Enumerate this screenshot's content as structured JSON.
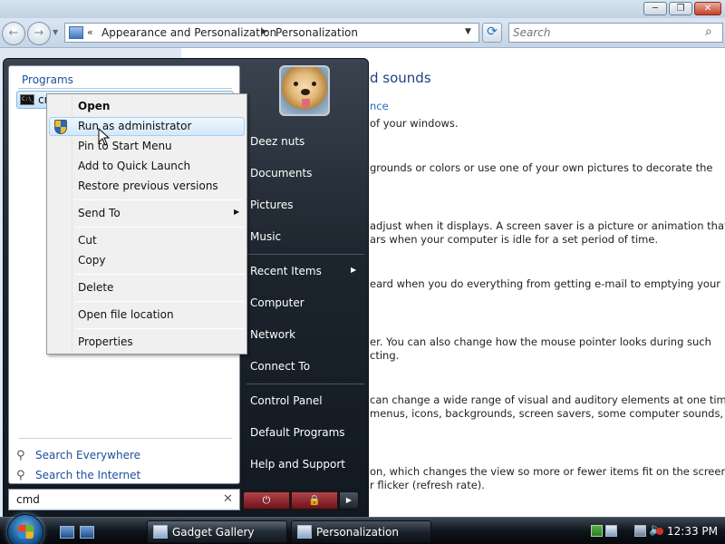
{
  "window": {
    "minimize_glyph": "─",
    "maximize_glyph": "❐",
    "close_glyph": "✕"
  },
  "navigation": {
    "back_glyph": "←",
    "forward_glyph": "→",
    "history_glyph": "▼",
    "breadcrumb_chevron": "«",
    "breadcrumb": [
      "Appearance and Personalization",
      "Personalization"
    ],
    "breadcrumb_separator": "▶",
    "dropdown_glyph": "▼",
    "refresh_glyph": "⟳",
    "search_placeholder": "Search",
    "search_icon_glyph": "⌕"
  },
  "content": {
    "title_fragment": "d sounds",
    "link_fragment": "nce",
    "descriptions": [
      "of your windows.",
      "grounds or colors or use one of your own pictures to decorate the",
      "adjust when it displays. A screen saver is a picture or animation that",
      "ars when your computer is idle for a set period of time.",
      "eard when you do everything from getting e-mail to emptying your",
      "er. You can also change how the mouse pointer looks during such",
      "cting.",
      "can change a wide range of visual and auditory elements at one time",
      "menus, icons, backgrounds, screen savers, some computer sounds, and",
      "on, which changes the view so more or fewer items fit on the screen.",
      "r flicker (refresh rate)."
    ]
  },
  "start_menu": {
    "programs_label": "Programs",
    "program_item": "cmd",
    "program_icon_text": "C:\\_",
    "search_everywhere": "Search Everywhere",
    "search_internet": "Search the Internet",
    "search_link_icon": "⚲",
    "search_value": "cmd",
    "clear_glyph": "✕",
    "right_items": {
      "user": "Deez nuts",
      "documents": "Documents",
      "pictures": "Pictures",
      "music": "Music",
      "recent_items": "Recent Items",
      "computer": "Computer",
      "network": "Network",
      "connect_to": "Connect To",
      "control_panel": "Control Panel",
      "default_programs": "Default Programs",
      "help_and_support": "Help and Support"
    },
    "submenu_arrow": "▶",
    "power_glyph": "⏻",
    "lock_glyph": "🔒",
    "power_options_glyph": "▶"
  },
  "context_menu": {
    "items": {
      "open": "Open",
      "run_as_admin": "Run as administrator",
      "pin_to_start": "Pin to Start Menu",
      "add_quick_launch": "Add to Quick Launch",
      "restore_versions": "Restore previous versions",
      "send_to": "Send To",
      "cut": "Cut",
      "copy": "Copy",
      "delete": "Delete",
      "open_file_location": "Open file location",
      "properties": "Properties"
    },
    "submenu_arrow": "▶"
  },
  "taskbar": {
    "buttons": [
      "Gadget Gallery",
      "Personalization"
    ],
    "volume_glyph": "🔈",
    "clock": "12:33 PM"
  },
  "icons": {
    "shield": "uac-shield-icon",
    "user_picture": "golden-retriever-avatar",
    "start": "windows-flag-icon"
  }
}
